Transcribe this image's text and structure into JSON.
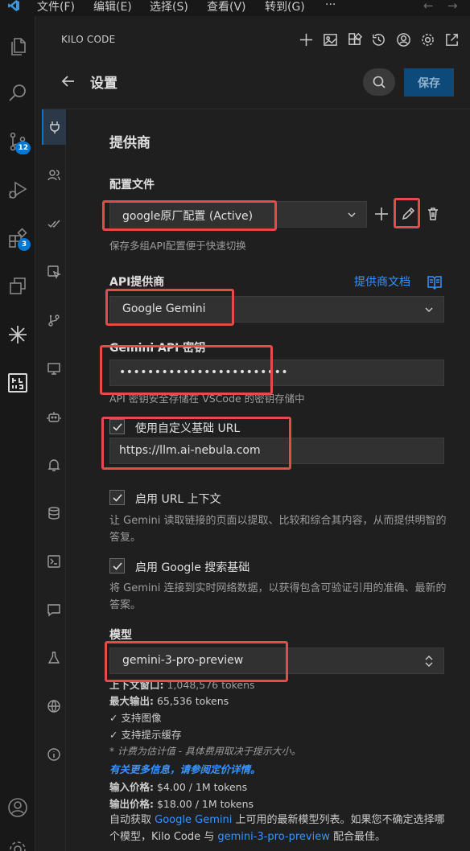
{
  "menubar": {
    "items": [
      "文件(F)",
      "编辑(E)",
      "选择(S)",
      "查看(V)",
      "转到(G)",
      "···"
    ],
    "back": "←",
    "forward": "→"
  },
  "activitybar": {
    "badges": {
      "source_control": "12",
      "extensions": "3"
    }
  },
  "panel": {
    "title": "KILO CODE",
    "header_icons": [
      "plus-icon",
      "image-icon",
      "marketplace-icon",
      "history-icon",
      "account-icon",
      "gear-icon",
      "popout-icon"
    ]
  },
  "settings": {
    "title": "设置",
    "save_label": "保存",
    "tabs": [
      "plug-icon",
      "users-icon",
      "checks-icon",
      "pointer-icon",
      "git-branch-icon",
      "monitor-icon",
      "bot-icon",
      "bell-icon",
      "database-icon",
      "terminal-icon",
      "comment-icon",
      "flask-icon",
      "globe-icon",
      "info-icon"
    ]
  },
  "provider": {
    "section_title": "提供商",
    "profile_label": "配置文件",
    "profile_value": "google原厂配置 (Active)",
    "profile_help": "保存多组API配置便于快速切换",
    "api_provider_label": "API提供商",
    "provider_docs_link": "提供商文档",
    "api_provider_value": "Google Gemini",
    "api_key_label": "Gemini API 密钥",
    "api_key_value": "••••••••••••••••••••••••",
    "api_key_help": "API 密钥安全存储在 VSCode 的密钥存储中",
    "custom_url_checkbox_label": "使用自定义基础 URL",
    "custom_url_value": "https://llm.ai-nebula.com",
    "url_context_label": "启用 URL 上下文",
    "url_context_help": "让 Gemini 读取链接的页面以提取、比较和综合其内容，从而提供明智的答复。",
    "grounding_label": "启用 Google 搜索基础",
    "grounding_help": "将 Gemini 连接到实时网络数据，以获得包含可验证引用的准确、最新的答案。",
    "model_label": "模型",
    "model_value": "gemini-3-pro-preview"
  },
  "model_info": {
    "context_window_label": "上下文窗口:",
    "context_window_value": "1,048,576 tokens",
    "max_output_label": "最大输出:",
    "max_output_value": "65,536 tokens",
    "supports_images": "支持图像",
    "supports_cache": "支持提示缓存",
    "cost_note": "* 计费为估计值 - 具体费用取决于提示大小。",
    "pricing_link": "有关更多信息，请参阅定价详情。",
    "input_price_label": "输入价格:",
    "input_price_value": "$4.00 / 1M tokens",
    "output_price_label": "输出价格:",
    "output_price_value": "$18.00 / 1M tokens",
    "auto_fetch_prefix": "自动获取 ",
    "auto_fetch_provider": "Google Gemini",
    "auto_fetch_middle": " 上可用的最新模型列表。如果您不确定选择哪个模型，Kilo Code 与 ",
    "auto_fetch_model": "gemini-3-pro-preview",
    "auto_fetch_suffix": " 配合最佳。"
  },
  "colors": {
    "accent": "#0078d4",
    "link": "#3794ff",
    "highlight_box": "#e54b4b",
    "save_button": "#0e4a79"
  }
}
